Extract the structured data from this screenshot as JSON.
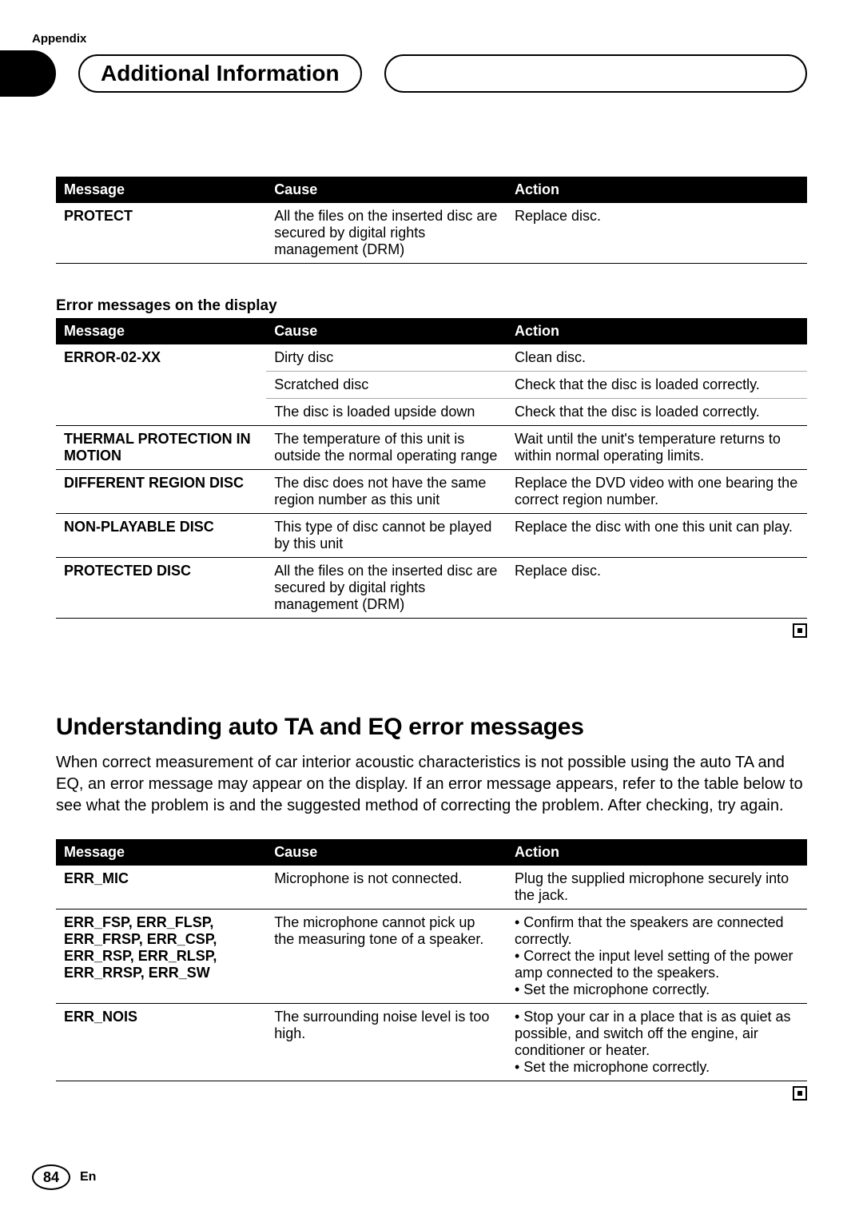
{
  "appendix_label": "Appendix",
  "header_title": "Additional Information",
  "table1": {
    "headers": {
      "message": "Message",
      "cause": "Cause",
      "action": "Action"
    },
    "rows": [
      {
        "message": "PROTECT",
        "cause": "All the files on the inserted disc are secured by digital rights management (DRM)",
        "action": "Replace disc."
      }
    ]
  },
  "subheading1": "Error messages on the display",
  "table2": {
    "headers": {
      "message": "Message",
      "cause": "Cause",
      "action": "Action"
    },
    "rows": [
      {
        "message": "ERROR-02-XX",
        "cause": "Dirty disc",
        "action": "Clean disc."
      },
      {
        "message": "",
        "cause": "Scratched disc",
        "action": "Check that the disc is loaded correctly."
      },
      {
        "message": "",
        "cause": "The disc is loaded upside down",
        "action": "Check that the disc is loaded correctly."
      },
      {
        "message": "THERMAL PROTECTION IN MOTION",
        "cause": "The temperature of this unit is outside the normal operating range",
        "action": "Wait until the unit's temperature returns to within normal operating limits."
      },
      {
        "message": "DIFFERENT REGION DISC",
        "cause": "The disc does not have the same region number as this unit",
        "action": "Replace the DVD video with one bearing the correct region number."
      },
      {
        "message": "NON-PLAYABLE DISC",
        "cause": "This type of disc cannot be played by this unit",
        "action": "Replace the disc with one this unit can play."
      },
      {
        "message": "PROTECTED DISC",
        "cause": "All the files on the inserted disc are secured by digital rights management (DRM)",
        "action": "Replace disc."
      }
    ]
  },
  "big_heading": "Understanding auto TA and EQ error messages",
  "intro_paragraph": "When correct measurement of car interior acoustic characteristics is not possible using the auto TA and EQ, an error message may appear on the display. If an error message appears, refer to the table below to see what the problem is and the suggested method of correcting the problem. After checking, try again.",
  "table3": {
    "headers": {
      "message": "Message",
      "cause": "Cause",
      "action": "Action"
    },
    "rows": [
      {
        "message": "ERR_MIC",
        "cause": "Microphone is not connected.",
        "action_plain": "Plug the supplied microphone securely into the jack."
      },
      {
        "message": "ERR_FSP, ERR_FLSP, ERR_FRSP, ERR_CSP, ERR_RSP, ERR_RLSP, ERR_RRSP, ERR_SW",
        "cause": "The microphone cannot pick up the measuring tone of a speaker.",
        "action_list": [
          "Confirm that the speakers are connected correctly.",
          "Correct the input level setting of the power amp connected to the speakers.",
          "Set the microphone correctly."
        ]
      },
      {
        "message": "ERR_NOIS",
        "cause": "The surrounding noise level is too high.",
        "action_list": [
          "Stop your car in a place that is as quiet as possible, and switch off the engine, air conditioner or heater.",
          "Set the microphone correctly."
        ]
      }
    ]
  },
  "footer": {
    "page_number": "84",
    "language": "En"
  }
}
